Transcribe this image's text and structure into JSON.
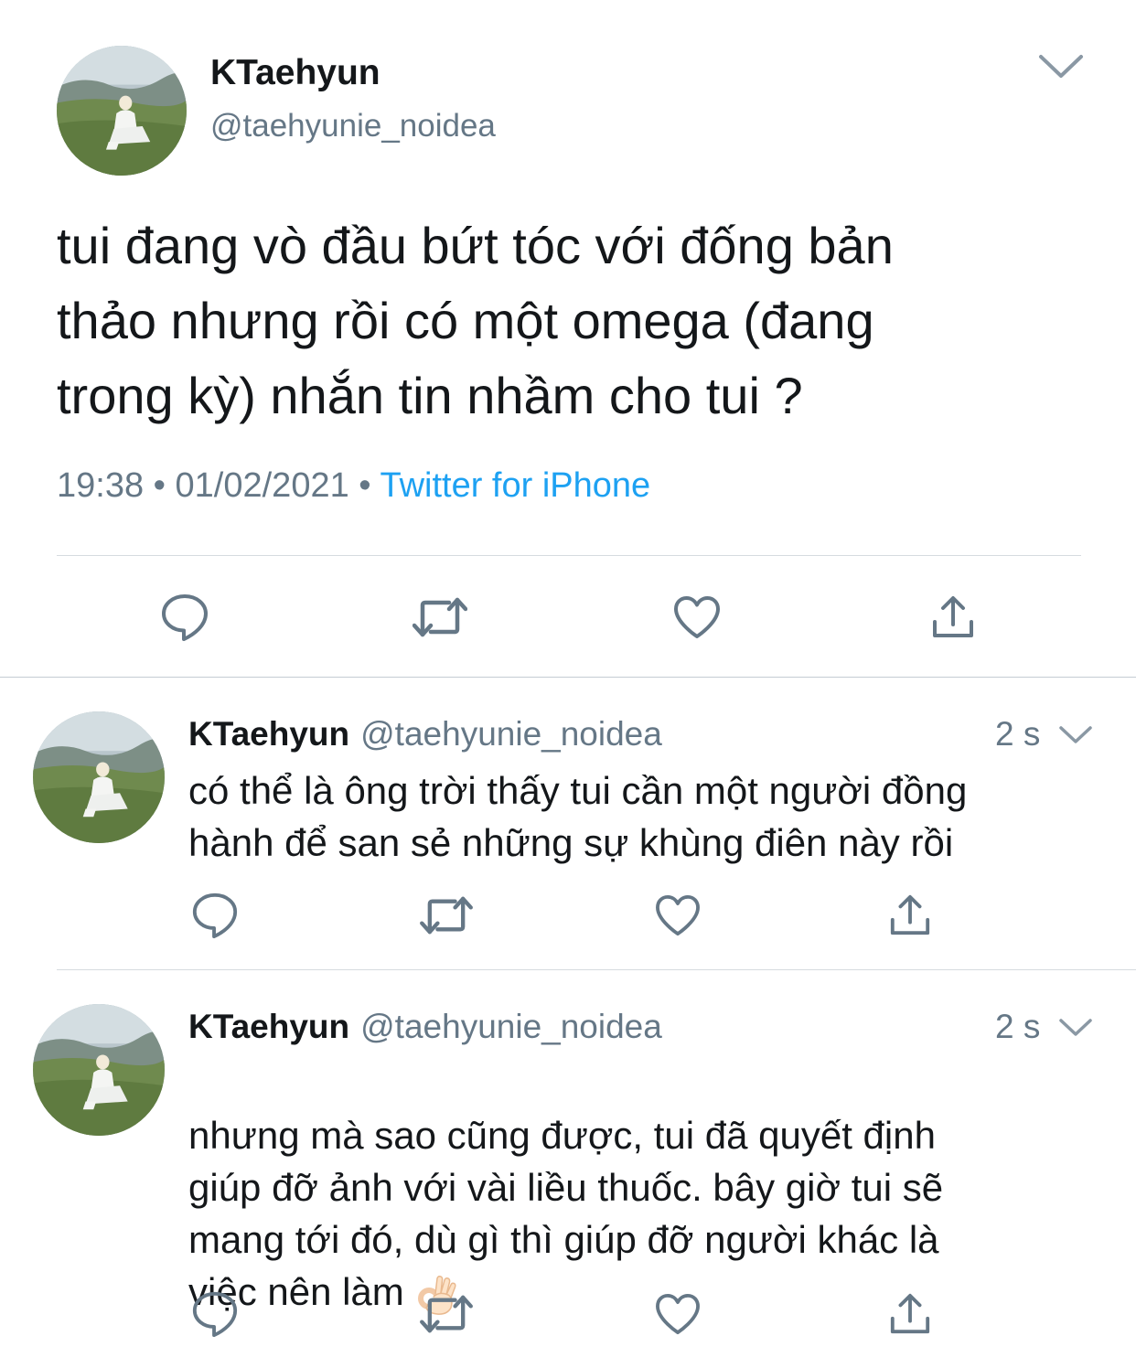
{
  "main_tweet": {
    "display_name": "KTaehyun",
    "handle": "@taehyunie_noidea",
    "text": "tui đang vò đầu bứt tóc với đống bản\nthảo nhưng rồi có một omega (đang\ntrong kỳ) nhắn tin nhầm cho tui ?",
    "time": "19:38",
    "date": "01/02/2021",
    "source": "Twitter for iPhone",
    "separator": "•"
  },
  "replies": [
    {
      "display_name": "KTaehyun",
      "handle": "@taehyunie_noidea",
      "time_ago": "2 s",
      "text": "có thể là ông trời thấy tui cần một người đồng\nhành để san sẻ những sự khùng điên này rồi"
    },
    {
      "display_name": "KTaehyun",
      "handle": "@taehyunie_noidea",
      "time_ago": "2 s",
      "text": "nhưng mà sao cũng được, tui đã quyết định\ngiúp đỡ ảnh với vài liều thuốc. bây giờ tui sẽ\nmang tới đó, dù gì thì giúp đỡ người khác là\nviệc nên làm",
      "emoji": "ok-hand-emoji"
    }
  ],
  "icons": {
    "reply": "reply-icon",
    "retweet": "retweet-icon",
    "like": "like-icon",
    "share": "share-icon",
    "menu": "chevron-down-icon"
  },
  "colors": {
    "text": "#14171a",
    "secondary": "#657786",
    "link": "#1da1f2",
    "divider": "#d6dbdf"
  }
}
